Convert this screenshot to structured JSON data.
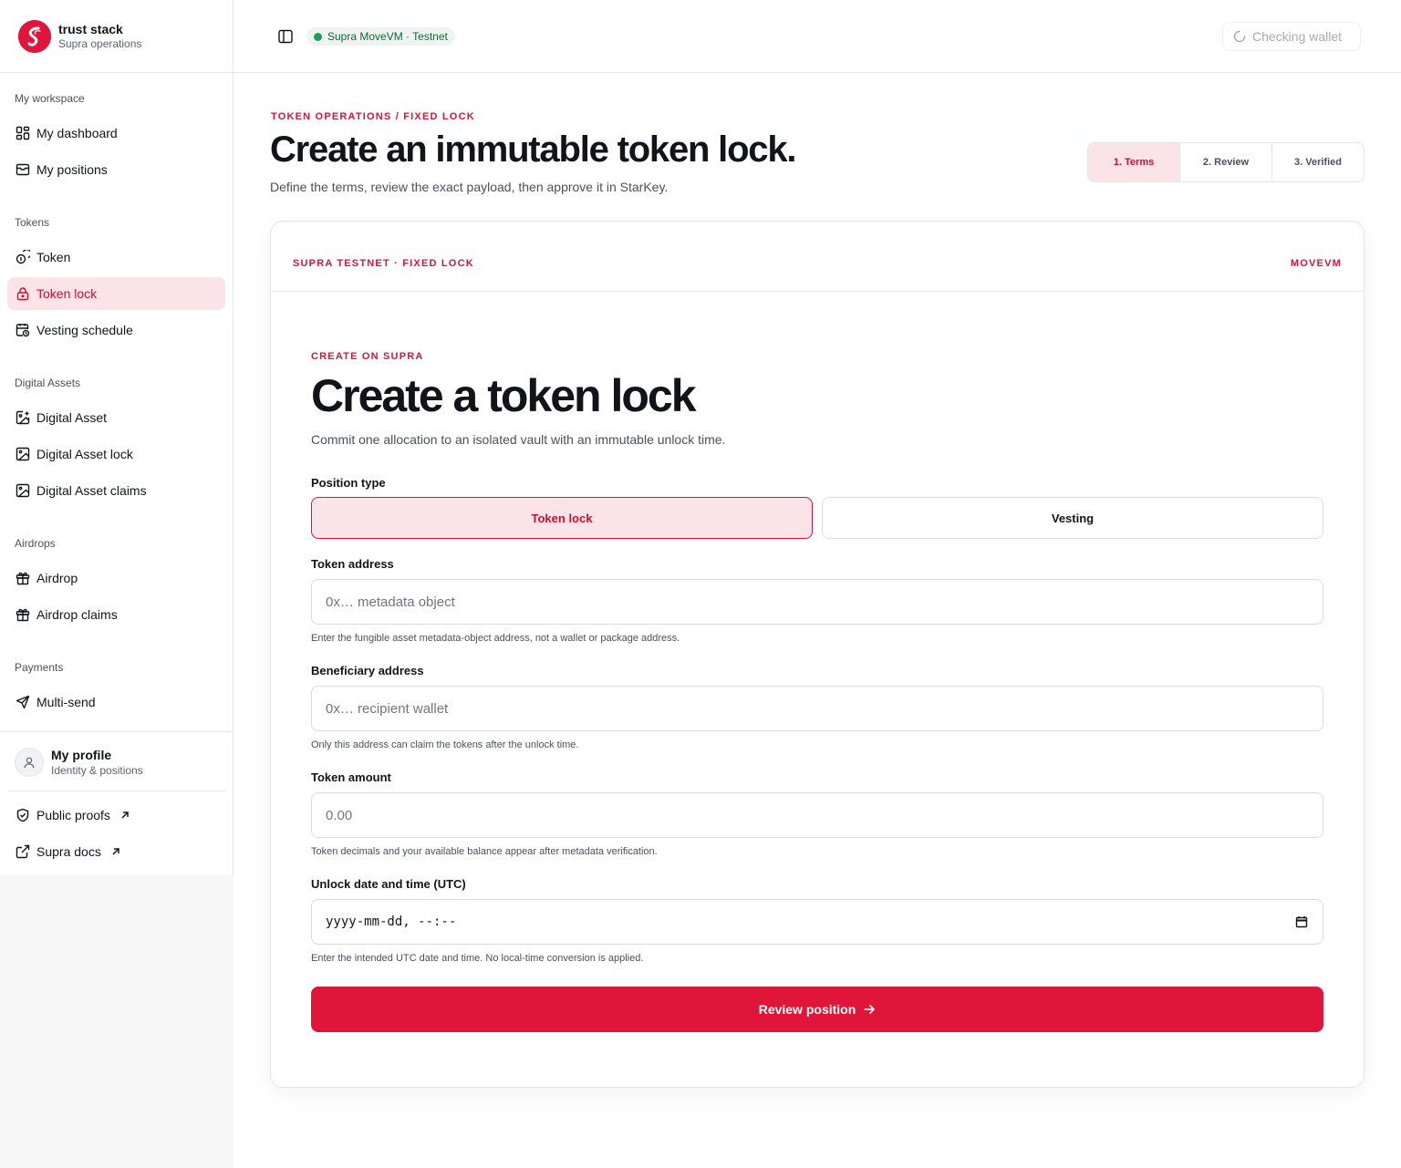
{
  "brand": {
    "name": "trust stack",
    "subtitle": "Supra operations"
  },
  "sidebar": {
    "sections": [
      {
        "label": "My workspace",
        "items": [
          {
            "label": "My dashboard",
            "icon": "dashboard-icon"
          },
          {
            "label": "My positions",
            "icon": "inbox-icon"
          }
        ]
      },
      {
        "label": "Tokens",
        "items": [
          {
            "label": "Token",
            "icon": "coins-icon"
          },
          {
            "label": "Token lock",
            "icon": "lock-icon",
            "active": true
          },
          {
            "label": "Vesting schedule",
            "icon": "calendar-clock-icon"
          }
        ]
      },
      {
        "label": "Digital Assets",
        "items": [
          {
            "label": "Digital Asset",
            "icon": "image-plus-icon"
          },
          {
            "label": "Digital Asset lock",
            "icon": "image-icon"
          },
          {
            "label": "Digital Asset claims",
            "icon": "image-icon"
          }
        ]
      },
      {
        "label": "Airdrops",
        "items": [
          {
            "label": "Airdrop",
            "icon": "gift-icon"
          },
          {
            "label": "Airdrop claims",
            "icon": "gift-icon"
          }
        ]
      },
      {
        "label": "Payments",
        "items": [
          {
            "label": "Multi-send",
            "icon": "send-icon"
          }
        ]
      }
    ],
    "profile": {
      "name": "My profile",
      "subtitle": "Identity & positions"
    },
    "footer_links": [
      {
        "label": "Public proofs",
        "icon": "shield-check-icon"
      },
      {
        "label": "Supra docs",
        "icon": "external-link-icon"
      }
    ]
  },
  "topbar": {
    "network": "Supra MoveVM · Testnet",
    "network_color": "#1f9d55",
    "wallet_status": "Checking wallet"
  },
  "page": {
    "kicker": "TOKEN OPERATIONS / FIXED LOCK",
    "title": "Create an immutable token lock.",
    "description": "Define the terms, review the exact payload, then approve it in StarKey.",
    "steps": [
      "1. Terms",
      "2. Review",
      "3. Verified"
    ],
    "active_step": 0
  },
  "card": {
    "head_left": "SUPRA TESTNET · FIXED LOCK",
    "head_right": "MOVEVM",
    "kicker": "CREATE ON SUPRA",
    "title": "Create a token lock",
    "description": "Commit one allocation to an isolated vault with an immutable unlock time.",
    "position_type": {
      "label": "Position type",
      "options": [
        "Token lock",
        "Vesting"
      ],
      "selected": "Token lock"
    },
    "token_address": {
      "label": "Token address",
      "placeholder": "0x… metadata object",
      "value": "",
      "hint": "Enter the fungible asset metadata-object address, not a wallet or package address."
    },
    "beneficiary": {
      "label": "Beneficiary address",
      "placeholder": "0x… recipient wallet",
      "value": "",
      "hint": "Only this address can claim the tokens after the unlock time."
    },
    "amount": {
      "label": "Token amount",
      "placeholder": "0.00",
      "value": "",
      "hint": "Token decimals and your available balance appear after metadata verification."
    },
    "unlock": {
      "label": "Unlock date and time (UTC)",
      "placeholder": "yyyy-mm-dd, --:--",
      "hint": "Enter the intended UTC date and time. No local-time conversion is applied."
    },
    "submit_label": "Review position"
  },
  "colors": {
    "accent": "#df1539",
    "accent_text": "#c8102e",
    "accent_soft": "#fbe4e8"
  }
}
